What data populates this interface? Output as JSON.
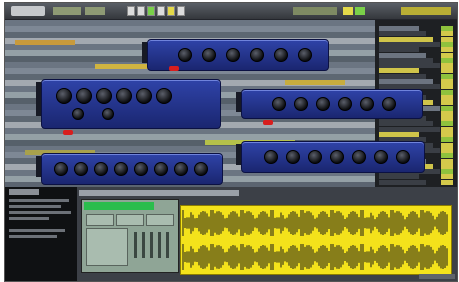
{
  "app": {
    "project_title": ""
  },
  "colors": {
    "background": "#23252b",
    "plugin_panel": "#2f43a8",
    "record_led": "#d81e1e",
    "waveform": "#f4e21b",
    "sampler_display": "#2bbd4d"
  },
  "transport": {
    "buttons": [
      "rewind-icon",
      "stop-icon",
      "play-icon",
      "record-icon",
      "loop-icon",
      "metronome-icon"
    ],
    "active": [
      "loop-icon",
      "play-icon"
    ]
  },
  "plugins": [
    {
      "name": "plugin-window-1",
      "knobs": 6
    },
    {
      "name": "plugin-window-2",
      "knobs": 8
    },
    {
      "name": "plugin-window-3",
      "knobs": 6
    },
    {
      "name": "plugin-window-4",
      "knobs": 8
    },
    {
      "name": "plugin-window-5",
      "knobs": 7
    }
  ]
}
